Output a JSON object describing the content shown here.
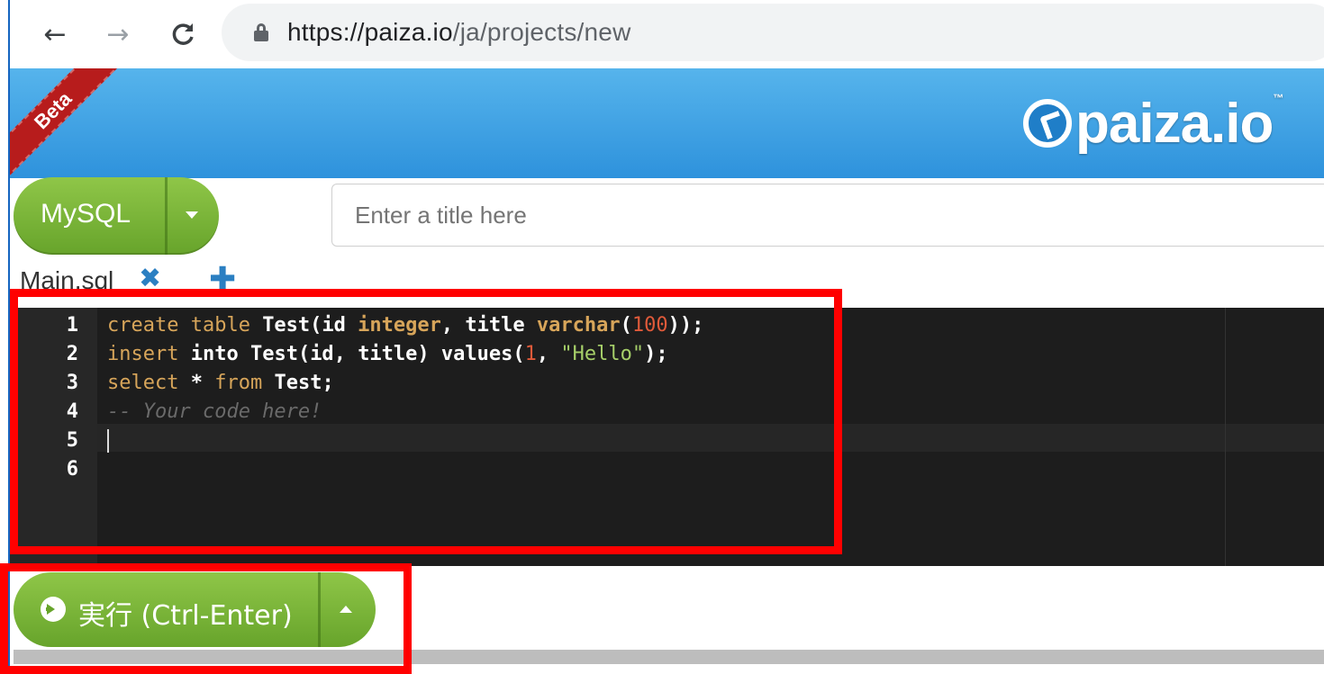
{
  "browser": {
    "url_host": "https://paiza.io",
    "url_path": "/ja/projects/new",
    "back_icon": "←",
    "forward_icon": "→",
    "reload_icon": "C"
  },
  "header": {
    "beta_ribbon": "Beta",
    "logo_text": "paiza.io",
    "logo_tm": "™"
  },
  "language_selector": {
    "label": "MySQL"
  },
  "title_input": {
    "placeholder": "Enter a title here",
    "value": ""
  },
  "tabs": {
    "label": "Main.sql",
    "close_icon": "✖",
    "add_icon": "✚"
  },
  "editor": {
    "line_numbers": [
      "1",
      "2",
      "3",
      "4",
      "5",
      "6"
    ],
    "lines": [
      "create table Test(id integer, title varchar(100));",
      "insert into Test(id, title) values(1, \"Hello\");",
      "select * from Test;",
      "-- Your code here!",
      "",
      ""
    ],
    "tokens": {
      "l1": [
        "create table ",
        "Test",
        "(",
        "id",
        " ",
        "integer",
        ", ",
        "title",
        " ",
        "varchar",
        "(",
        "100",
        "));"
      ],
      "l2": [
        "insert ",
        "into",
        " ",
        "Test",
        "(",
        "id",
        ", ",
        "title",
        ") ",
        "values",
        "(",
        "1",
        ", ",
        "\"Hello\"",
        ");"
      ],
      "l3": [
        "select",
        " * ",
        "from",
        " ",
        "Test",
        ";"
      ],
      "l4": [
        "-- Your code here!"
      ]
    }
  },
  "run_button": {
    "label": "実行 (Ctrl-Enter)"
  },
  "colors": {
    "header_blue": "#2e92dc",
    "button_green": "#67a42b",
    "editor_bg": "#1d1d1d",
    "annotation_red": "#ff0000"
  }
}
